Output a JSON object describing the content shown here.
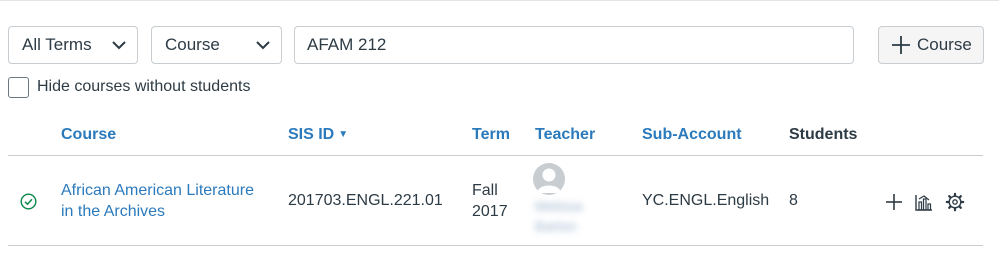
{
  "filters": {
    "terms_select": "All Terms",
    "course_type_select": "Course",
    "search_value": "AFAM 212",
    "add_course_label": "Course",
    "hide_empty_label": "Hide courses without students",
    "hide_empty_checked": false
  },
  "table": {
    "headers": {
      "course": "Course",
      "sis_id": "SIS ID",
      "term": "Term",
      "teacher": "Teacher",
      "sub_account": "Sub-Account",
      "students": "Students"
    },
    "sort_indicator": "▼",
    "rows": [
      {
        "course_line1": "African American Literature",
        "course_line2": "in the Archives",
        "sis_id": "201703.ENGL.221.01",
        "term_line1": "Fall",
        "term_line2": "2017",
        "teacher_line1": "Melissa",
        "teacher_line2": "Barton",
        "sub_account": "YC.ENGL.English",
        "students": "8",
        "status_icon": "published-check-icon"
      }
    ]
  },
  "icons": {
    "dropdown": "chevron-down-icon",
    "add": "plus-icon",
    "row_actions": [
      "plus-icon",
      "statistics-icon",
      "gear-icon"
    ]
  },
  "colors": {
    "link": "#2b7abc",
    "text": "#2d3b45",
    "border": "#c7cdd1",
    "success": "#0b874b"
  }
}
